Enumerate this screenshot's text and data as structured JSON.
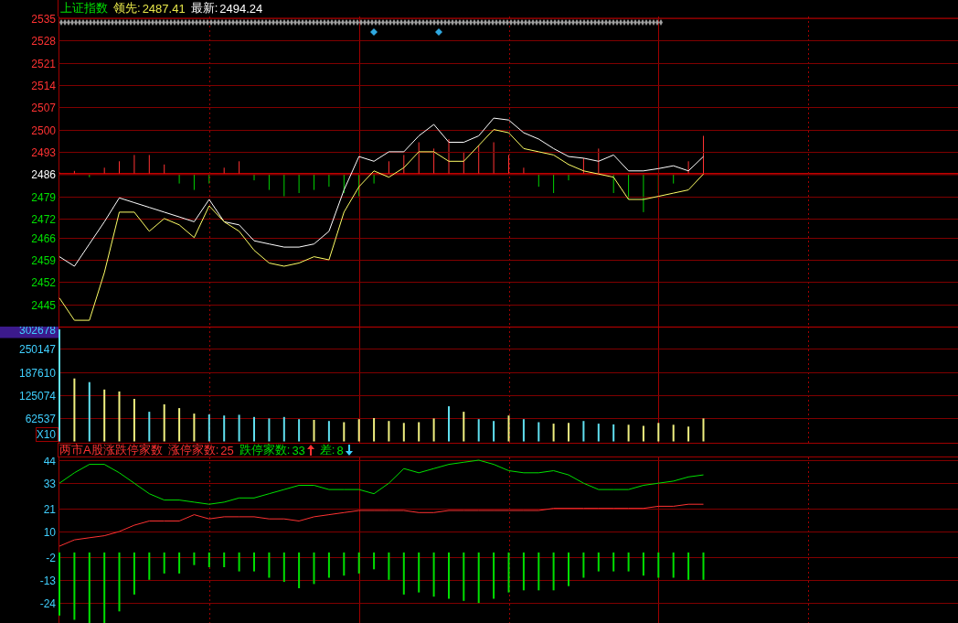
{
  "header": {
    "title": "上证指数",
    "items": [
      {
        "label": "领先:",
        "value": "2487.41",
        "color": "#e8e84a"
      },
      {
        "label": "最新:",
        "value": "2494.24",
        "color": "#ffffff"
      }
    ]
  },
  "price_chart": {
    "chart_data": {
      "type": "line",
      "categories": [
        null,
        null,
        null,
        null,
        null,
        null,
        null,
        null,
        null,
        null,
        null,
        null,
        null,
        null,
        null,
        null,
        null,
        null,
        null,
        null,
        null,
        null,
        null,
        null,
        null,
        null,
        null,
        null,
        null,
        null,
        null,
        null,
        null,
        null,
        null,
        null,
        null,
        null,
        null,
        null,
        null,
        null,
        null,
        null
      ],
      "grid": true,
      "ylim": [
        2438,
        2535
      ],
      "yticks": [
        2535,
        2528,
        2521,
        2514,
        2507,
        2500,
        2493,
        2486,
        2479,
        2472,
        2466,
        2459,
        2452,
        2445
      ],
      "series": [
        {
          "color": "#ffffff",
          "values": [
            2460,
            2457,
            2464,
            2471,
            2478.5,
            2477,
            2475.5,
            2474,
            2472.5,
            2471,
            2478,
            2471,
            2470,
            2465,
            2464,
            2463,
            2463,
            2464,
            2468,
            2481,
            2491.5,
            2490,
            2493,
            2493,
            2498,
            2501.6,
            2496,
            2496,
            2498,
            2503.6,
            2503,
            2499,
            2497,
            2494,
            2491.5,
            2491,
            2490,
            2492,
            2487,
            2487,
            2487.7,
            2488.6,
            2487,
            2491.5
          ]
        },
        {
          "color": "#ffff66",
          "values": [
            2447,
            2440,
            2440,
            2455,
            2474,
            2474,
            2468,
            2472,
            2470,
            2466,
            2476,
            2471,
            2468,
            2462,
            2458,
            2457,
            2458,
            2460,
            2459,
            2474,
            2482,
            2487,
            2485,
            2488,
            2493,
            2493,
            2490,
            2490,
            2495,
            2500,
            2499,
            2494,
            2493,
            2492,
            2489,
            2487,
            2486,
            2485,
            2478,
            2478,
            2479,
            2480,
            2481,
            2486
          ]
        }
      ]
    }
  },
  "volume_chart": {
    "unit_label": "X10",
    "chart_data": {
      "type": "bar",
      "categories": [
        null,
        null,
        null,
        null,
        null,
        null,
        null,
        null,
        null,
        null,
        null,
        null,
        null,
        null,
        null,
        null,
        null,
        null,
        null,
        null,
        null,
        null,
        null,
        null,
        null,
        null,
        null,
        null,
        null,
        null,
        null,
        null,
        null,
        null,
        null,
        null,
        null,
        null,
        null,
        null,
        null,
        null,
        null,
        null
      ],
      "grid": true,
      "ylim": [
        0,
        302678
      ],
      "yticks": [
        302678,
        250147,
        187610,
        125074,
        62537
      ],
      "series": [
        {
          "color": "#f0f080",
          "values": [
            null,
            170000,
            null,
            140000,
            135000,
            115000,
            null,
            100000,
            90000,
            75000,
            null,
            null,
            null,
            null,
            null,
            null,
            null,
            58000,
            null,
            52000,
            60000,
            63000,
            55000,
            50000,
            52000,
            62000,
            null,
            80000,
            null,
            null,
            70000,
            null,
            null,
            48000,
            50000,
            null,
            null,
            null,
            45000,
            42000,
            50000,
            45000,
            40000,
            62000
          ]
        },
        {
          "color": "#60e0f0",
          "values": [
            302678,
            null,
            160000,
            null,
            null,
            null,
            80000,
            null,
            null,
            null,
            73000,
            70000,
            72000,
            66000,
            62000,
            66000,
            60000,
            null,
            55000,
            null,
            null,
            null,
            null,
            null,
            null,
            null,
            95000,
            null,
            60000,
            55000,
            null,
            60000,
            52000,
            null,
            null,
            55000,
            48000,
            46000,
            null,
            null,
            null,
            null,
            null,
            null
          ]
        }
      ]
    }
  },
  "limit_chart": {
    "title": "两市A股涨跌停家数",
    "items": [
      {
        "label": "涨停家数:",
        "value": "25",
        "color": "#ff3232",
        "kind": "plain"
      },
      {
        "label": "跌停家数:",
        "value": "33",
        "color": "#00e000",
        "kind": "up"
      },
      {
        "label": "差:",
        "value": "8",
        "color": "#00e000",
        "kind": "down"
      }
    ],
    "counts": {
      "chart_data": {
        "type": "line",
        "categories": [
          null,
          null,
          null,
          null,
          null,
          null,
          null,
          null,
          null,
          null,
          null,
          null,
          null,
          null,
          null,
          null,
          null,
          null,
          null,
          null,
          null,
          null,
          null,
          null,
          null,
          null,
          null,
          null,
          null,
          null,
          null,
          null,
          null,
          null,
          null,
          null,
          null,
          null,
          null,
          null,
          null,
          null,
          null,
          null
        ],
        "grid": true,
        "ylim": [
          1.7,
          44
        ],
        "yticks": [
          44,
          33,
          21,
          10
        ],
        "series": [
          {
            "color": "#00e000",
            "values": [
              33,
              38,
              42,
              42,
              38,
              33,
              28,
              25,
              25,
              24,
              23,
              24,
              26,
              26,
              28,
              30,
              32,
              32,
              30,
              30,
              30,
              28,
              33,
              40,
              38,
              40,
              42,
              43,
              44,
              42,
              39,
              38,
              38,
              39,
              37,
              33,
              30,
              30,
              30,
              32,
              33,
              34,
              36,
              37
            ]
          },
          {
            "color": "#ff3232",
            "values": [
              3,
              6,
              7,
              8,
              10,
              13,
              15,
              15,
              15,
              18,
              16,
              17,
              17,
              17,
              16,
              16,
              15,
              17,
              18,
              19,
              20,
              20,
              20,
              20,
              19,
              19,
              20,
              20,
              20,
              20,
              20,
              20,
              20,
              21,
              21,
              21,
              21,
              21,
              21,
              21,
              22,
              22,
              23,
              23
            ]
          }
        ]
      }
    },
    "difference": {
      "chart_data": {
        "type": "bar",
        "categories": [
          null,
          null,
          null,
          null,
          null,
          null,
          null,
          null,
          null,
          null,
          null,
          null,
          null,
          null,
          null,
          null,
          null,
          null,
          null,
          null,
          null,
          null,
          null,
          null,
          null,
          null,
          null,
          null,
          null,
          null,
          null,
          null,
          null,
          null,
          null,
          null,
          null,
          null,
          null,
          null,
          null,
          null,
          null,
          null
        ],
        "grid": true,
        "ylim": [
          -34.4,
          1.7
        ],
        "yticks": [
          -2,
          -13,
          -24
        ],
        "series": [
          {
            "color": "#00e000",
            "values": [
              -30,
              -32,
              -34,
              -34,
              -28,
              -20,
              -13,
              -10,
              -10,
              -6,
              -7,
              -7,
              -9,
              -9,
              -12,
              -14,
              -17,
              -15,
              -12,
              -11,
              -10,
              -8,
              -13,
              -20,
              -19,
              -21,
              -22,
              -23,
              -24,
              -22,
              -19,
              -18,
              -18,
              -18,
              -16,
              -12,
              -9,
              -9,
              -9,
              -11,
              -12,
              -12,
              -13,
              -13
            ]
          }
        ]
      }
    }
  }
}
